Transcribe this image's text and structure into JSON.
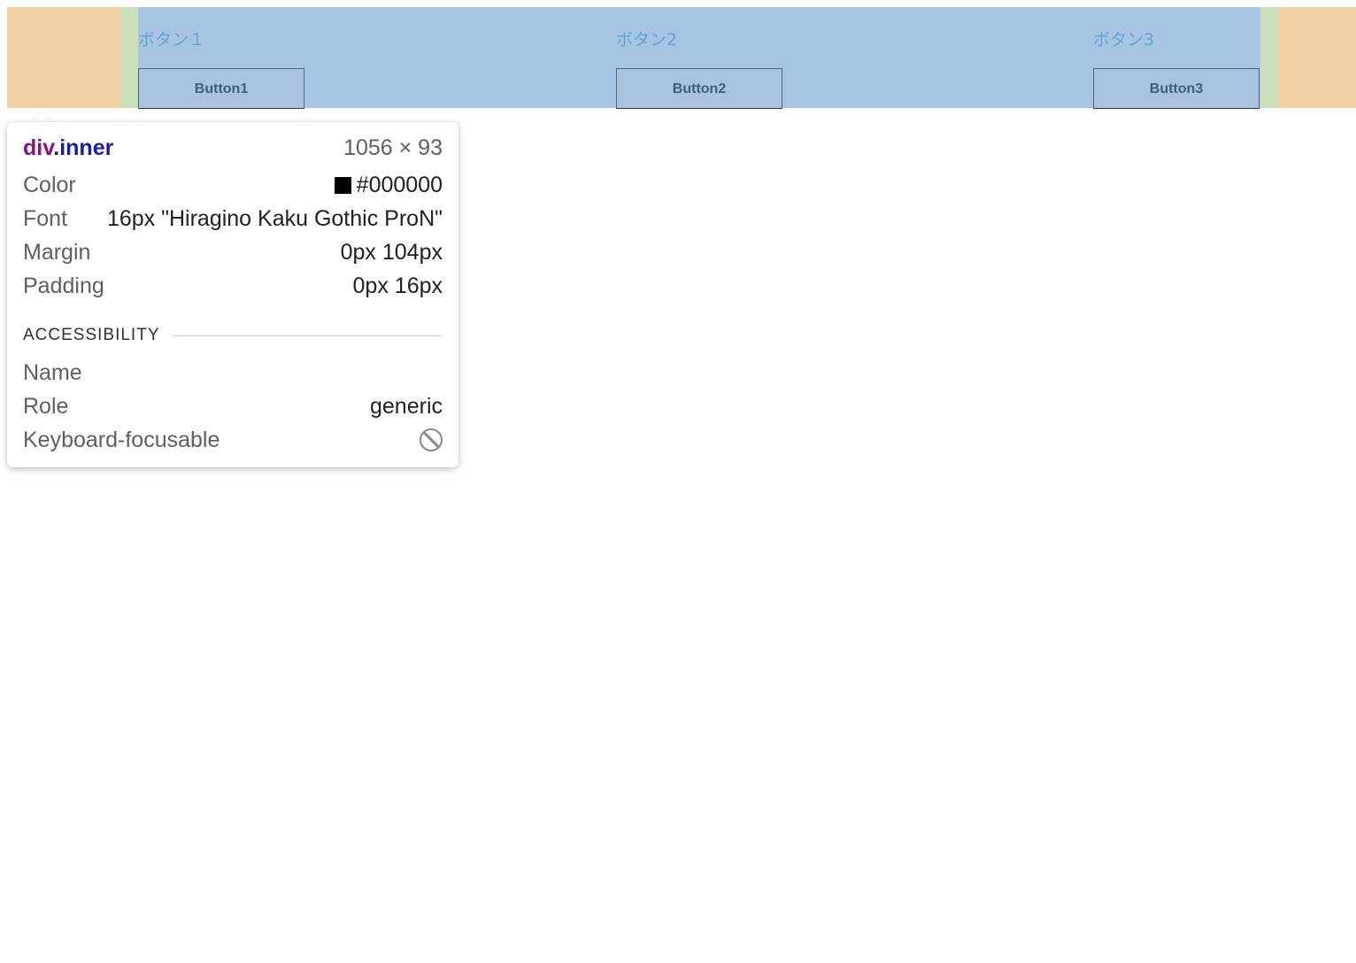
{
  "page": {
    "columns": [
      {
        "label": "ボタン１",
        "button_label": "Button1"
      },
      {
        "label": "ボタン2",
        "button_label": "Button2"
      },
      {
        "label": "ボタン3",
        "button_label": "Button3"
      }
    ],
    "overlay_colors": {
      "margin": "#f3cfa4",
      "padding": "#cbdfbb",
      "content": "#a7c4e5"
    }
  },
  "inspector": {
    "tag": "div",
    "class_name": ".inner",
    "size": "1056 × 93",
    "properties": [
      {
        "key": "Color",
        "value": "#000000",
        "swatch": "#000000"
      },
      {
        "key": "Font",
        "value": "16px \"Hiragino Kaku Gothic ProN\""
      },
      {
        "key": "Margin",
        "value": "0px 104px"
      },
      {
        "key": "Padding",
        "value": "0px 16px"
      }
    ],
    "accessibility": {
      "title": "ACCESSIBILITY",
      "name_label": "Name",
      "name_value": "",
      "role_label": "Role",
      "role_value": "generic",
      "focusable_label": "Keyboard-focusable",
      "focusable_icon": "not-allowed-icon"
    }
  }
}
